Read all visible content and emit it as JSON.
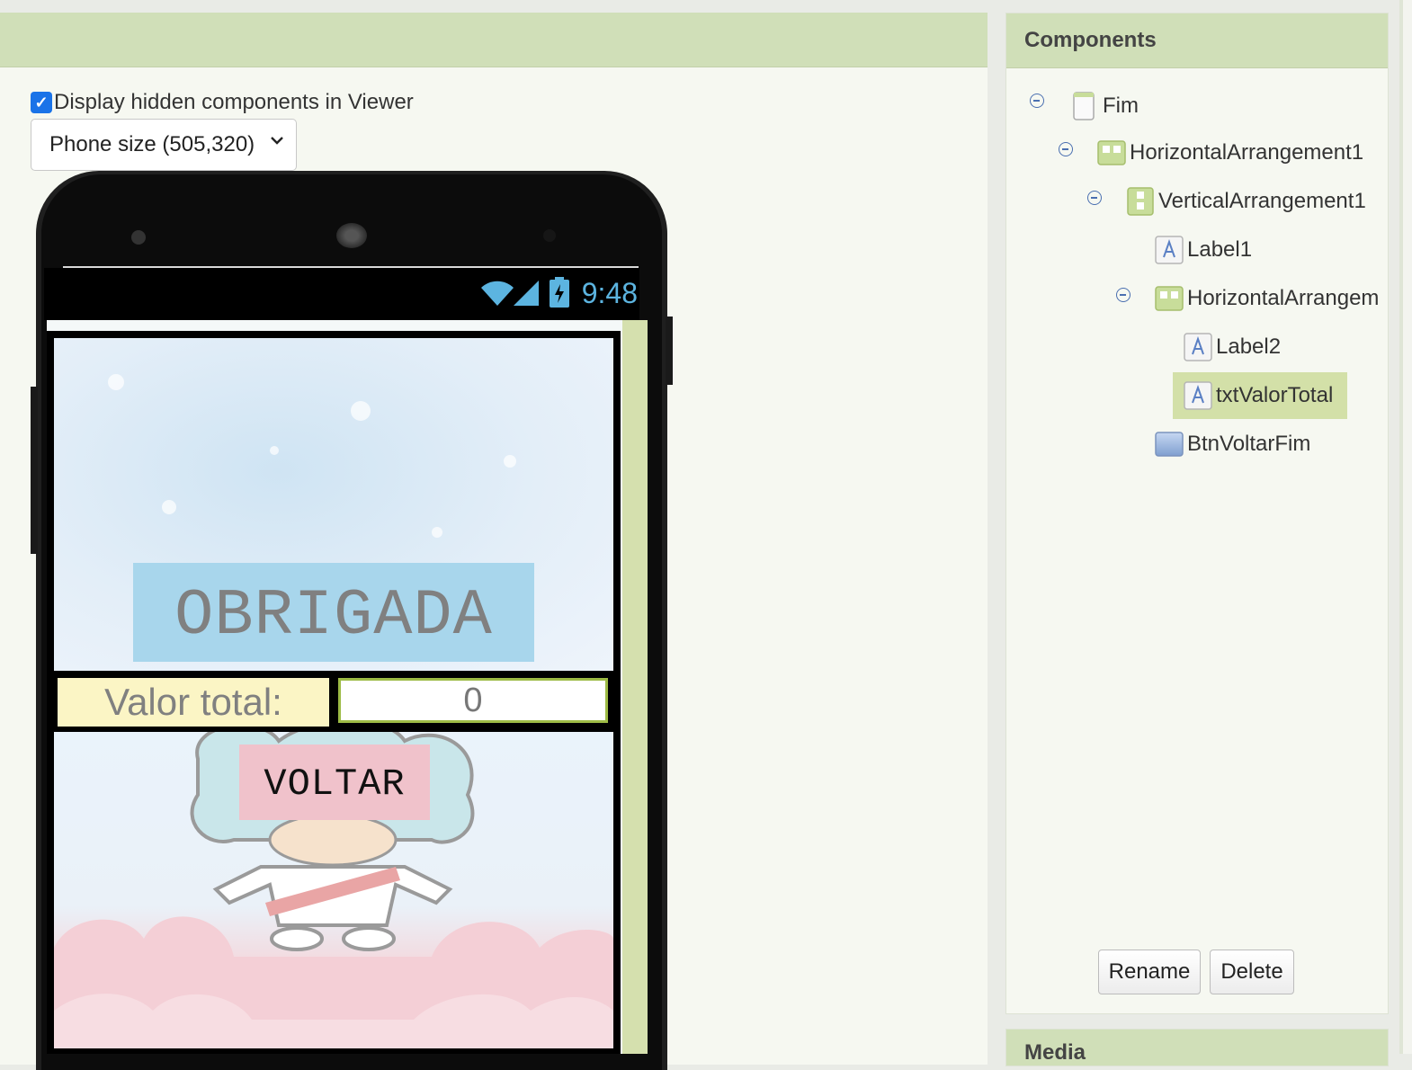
{
  "viewer": {
    "hidden_components_label": "Display hidden components in Viewer",
    "hidden_components_checked": true,
    "phone_size_selected": "Phone size (505,320)"
  },
  "phone": {
    "status_time": "9:48",
    "screen": {
      "title_label": "OBRIGADA",
      "valor_label": "Valor total:",
      "valor_value": "0",
      "back_button": "VOLTAR"
    }
  },
  "components": {
    "title": "Components",
    "tree": [
      {
        "name": "Fim",
        "icon": "screen-icon"
      },
      {
        "name": "HorizontalArrangement1",
        "icon": "horizontal-arrangement-icon"
      },
      {
        "name": "VerticalArrangement1",
        "icon": "vertical-arrangement-icon"
      },
      {
        "name": "Label1",
        "icon": "label-icon"
      },
      {
        "name": "HorizontalArrangem",
        "icon": "horizontal-arrangement-icon"
      },
      {
        "name": "Label2",
        "icon": "label-icon"
      },
      {
        "name": "txtValorTotal",
        "icon": "label-icon",
        "selected": true
      },
      {
        "name": "BtnVoltarFim",
        "icon": "button-icon"
      }
    ],
    "rename_label": "Rename",
    "delete_label": "Delete"
  },
  "media": {
    "title": "Media"
  },
  "colors": {
    "header_green": "#d0dfb8",
    "selected_row": "#d3e0a8",
    "obrigada_bg": "#a8d6ec",
    "valor_bg": "#fbf5c5",
    "voltar_bg": "#f0c2cb",
    "status_clock": "#5cb4e0"
  }
}
